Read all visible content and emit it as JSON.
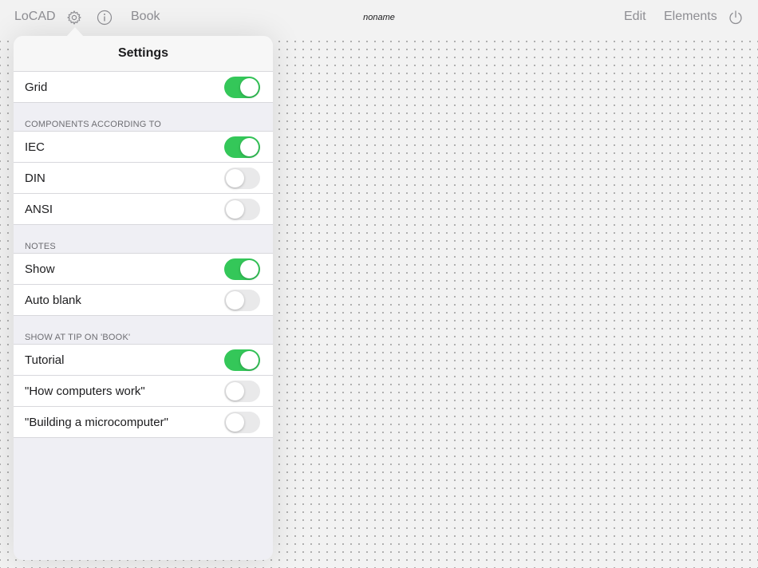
{
  "topbar": {
    "app_name": "LoCAD",
    "settings_icon": "gear-icon",
    "info_icon": "info-icon",
    "book_label": "Book",
    "document_title": "noname",
    "edit_label": "Edit",
    "elements_label": "Elements",
    "power_icon": "power-icon"
  },
  "settings": {
    "title": "Settings",
    "grid": {
      "label": "Grid",
      "on": true
    },
    "components_header": "COMPONENTS ACCORDING TO",
    "components": [
      {
        "label": "IEC",
        "on": true
      },
      {
        "label": "DIN",
        "on": false
      },
      {
        "label": "ANSI",
        "on": false
      }
    ],
    "notes_header": "NOTES",
    "notes": [
      {
        "label": "Show",
        "on": true
      },
      {
        "label": "Auto blank",
        "on": false
      }
    ],
    "tip_header": "SHOW AT TIP ON 'BOOK'",
    "tips": [
      {
        "label": "Tutorial",
        "on": true
      },
      {
        "label": "\"How computers work\"",
        "on": false
      },
      {
        "label": "\"Building a microcomputer\"",
        "on": false
      }
    ]
  },
  "colors": {
    "toggle_on": "#34c759",
    "toggle_off": "#e9e9ea",
    "toolbar_text": "#8e8e93"
  }
}
